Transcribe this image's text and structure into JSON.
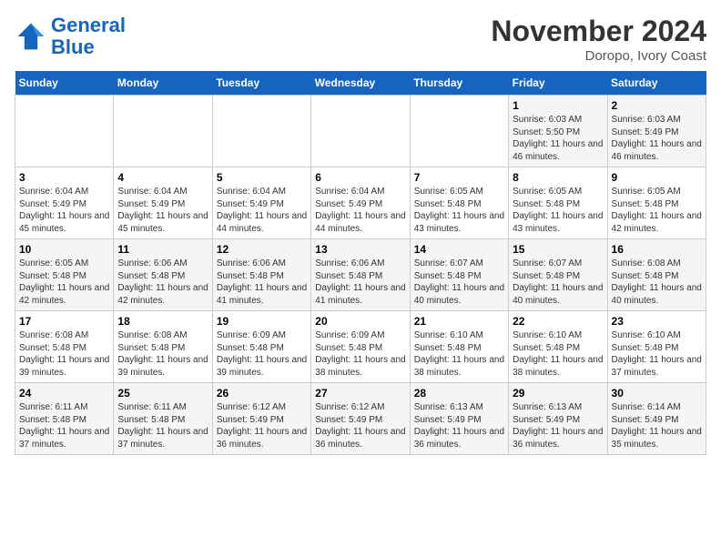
{
  "header": {
    "logo_line1": "General",
    "logo_line2": "Blue",
    "month": "November 2024",
    "location": "Doropo, Ivory Coast"
  },
  "weekdays": [
    "Sunday",
    "Monday",
    "Tuesday",
    "Wednesday",
    "Thursday",
    "Friday",
    "Saturday"
  ],
  "weeks": [
    [
      {
        "day": "",
        "info": ""
      },
      {
        "day": "",
        "info": ""
      },
      {
        "day": "",
        "info": ""
      },
      {
        "day": "",
        "info": ""
      },
      {
        "day": "",
        "info": ""
      },
      {
        "day": "1",
        "info": "Sunrise: 6:03 AM\nSunset: 5:50 PM\nDaylight: 11 hours and 46 minutes."
      },
      {
        "day": "2",
        "info": "Sunrise: 6:03 AM\nSunset: 5:49 PM\nDaylight: 11 hours and 46 minutes."
      }
    ],
    [
      {
        "day": "3",
        "info": "Sunrise: 6:04 AM\nSunset: 5:49 PM\nDaylight: 11 hours and 45 minutes."
      },
      {
        "day": "4",
        "info": "Sunrise: 6:04 AM\nSunset: 5:49 PM\nDaylight: 11 hours and 45 minutes."
      },
      {
        "day": "5",
        "info": "Sunrise: 6:04 AM\nSunset: 5:49 PM\nDaylight: 11 hours and 44 minutes."
      },
      {
        "day": "6",
        "info": "Sunrise: 6:04 AM\nSunset: 5:49 PM\nDaylight: 11 hours and 44 minutes."
      },
      {
        "day": "7",
        "info": "Sunrise: 6:05 AM\nSunset: 5:48 PM\nDaylight: 11 hours and 43 minutes."
      },
      {
        "day": "8",
        "info": "Sunrise: 6:05 AM\nSunset: 5:48 PM\nDaylight: 11 hours and 43 minutes."
      },
      {
        "day": "9",
        "info": "Sunrise: 6:05 AM\nSunset: 5:48 PM\nDaylight: 11 hours and 42 minutes."
      }
    ],
    [
      {
        "day": "10",
        "info": "Sunrise: 6:05 AM\nSunset: 5:48 PM\nDaylight: 11 hours and 42 minutes."
      },
      {
        "day": "11",
        "info": "Sunrise: 6:06 AM\nSunset: 5:48 PM\nDaylight: 11 hours and 42 minutes."
      },
      {
        "day": "12",
        "info": "Sunrise: 6:06 AM\nSunset: 5:48 PM\nDaylight: 11 hours and 41 minutes."
      },
      {
        "day": "13",
        "info": "Sunrise: 6:06 AM\nSunset: 5:48 PM\nDaylight: 11 hours and 41 minutes."
      },
      {
        "day": "14",
        "info": "Sunrise: 6:07 AM\nSunset: 5:48 PM\nDaylight: 11 hours and 40 minutes."
      },
      {
        "day": "15",
        "info": "Sunrise: 6:07 AM\nSunset: 5:48 PM\nDaylight: 11 hours and 40 minutes."
      },
      {
        "day": "16",
        "info": "Sunrise: 6:08 AM\nSunset: 5:48 PM\nDaylight: 11 hours and 40 minutes."
      }
    ],
    [
      {
        "day": "17",
        "info": "Sunrise: 6:08 AM\nSunset: 5:48 PM\nDaylight: 11 hours and 39 minutes."
      },
      {
        "day": "18",
        "info": "Sunrise: 6:08 AM\nSunset: 5:48 PM\nDaylight: 11 hours and 39 minutes."
      },
      {
        "day": "19",
        "info": "Sunrise: 6:09 AM\nSunset: 5:48 PM\nDaylight: 11 hours and 39 minutes."
      },
      {
        "day": "20",
        "info": "Sunrise: 6:09 AM\nSunset: 5:48 PM\nDaylight: 11 hours and 38 minutes."
      },
      {
        "day": "21",
        "info": "Sunrise: 6:10 AM\nSunset: 5:48 PM\nDaylight: 11 hours and 38 minutes."
      },
      {
        "day": "22",
        "info": "Sunrise: 6:10 AM\nSunset: 5:48 PM\nDaylight: 11 hours and 38 minutes."
      },
      {
        "day": "23",
        "info": "Sunrise: 6:10 AM\nSunset: 5:48 PM\nDaylight: 11 hours and 37 minutes."
      }
    ],
    [
      {
        "day": "24",
        "info": "Sunrise: 6:11 AM\nSunset: 5:48 PM\nDaylight: 11 hours and 37 minutes."
      },
      {
        "day": "25",
        "info": "Sunrise: 6:11 AM\nSunset: 5:48 PM\nDaylight: 11 hours and 37 minutes."
      },
      {
        "day": "26",
        "info": "Sunrise: 6:12 AM\nSunset: 5:49 PM\nDaylight: 11 hours and 36 minutes."
      },
      {
        "day": "27",
        "info": "Sunrise: 6:12 AM\nSunset: 5:49 PM\nDaylight: 11 hours and 36 minutes."
      },
      {
        "day": "28",
        "info": "Sunrise: 6:13 AM\nSunset: 5:49 PM\nDaylight: 11 hours and 36 minutes."
      },
      {
        "day": "29",
        "info": "Sunrise: 6:13 AM\nSunset: 5:49 PM\nDaylight: 11 hours and 36 minutes."
      },
      {
        "day": "30",
        "info": "Sunrise: 6:14 AM\nSunset: 5:49 PM\nDaylight: 11 hours and 35 minutes."
      }
    ]
  ]
}
